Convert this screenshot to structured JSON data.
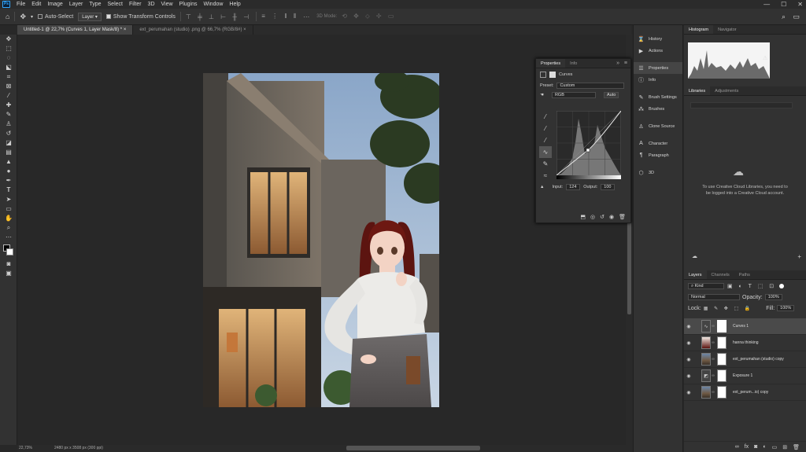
{
  "app": {
    "logo": "Ps"
  },
  "menu": [
    "File",
    "Edit",
    "Image",
    "Layer",
    "Type",
    "Select",
    "Filter",
    "3D",
    "View",
    "Plugins",
    "Window",
    "Help"
  ],
  "window_controls": {
    "minimize": "—",
    "maximize": "☐",
    "close": "✕"
  },
  "options": {
    "auto_select_label": "Auto-Select",
    "auto_select_target": "Layer",
    "transform_controls_label": "Show Transform Controls",
    "mode_3d_label": "3D Mode:"
  },
  "tabs": [
    {
      "label": "Untitled-1 @ 22,7% (Curves 1, Layer Mask/8) *",
      "close": "×"
    },
    {
      "label": "ext_perumahan (studio) .png @ 66,7% (RGB/8#)",
      "close": "×"
    }
  ],
  "status": {
    "zoom": "22,73%",
    "doc_info": "2480 px x 3508 px (300 ppi)"
  },
  "dock": {
    "history": "History",
    "actions": "Actions",
    "properties": "Properties",
    "info": "Info",
    "brush_settings": "Brush Settings",
    "brushes": "Brushes",
    "clone_source": "Clone Source",
    "character": "Character",
    "paragraph": "Paragraph",
    "3d": "3D"
  },
  "properties_panel": {
    "tab_properties": "Properties",
    "tab_info": "Info",
    "adjustment_name": "Curves",
    "preset_label": "Preset:",
    "preset_value": "Custom",
    "channel_value": "RGB",
    "auto_label": "Auto",
    "input_label": "Input:",
    "input_value": "124",
    "output_label": "Output:",
    "output_value": "100"
  },
  "histogram_panel": {
    "tab_histogram": "Histogram",
    "tab_navigator": "Navigator",
    "warning": "⚠"
  },
  "libraries_panel": {
    "tab_libraries": "Libraries",
    "tab_adjustments": "Adjustments",
    "message": "To use Creative Cloud Libraries, you need to be logged into a Creative Cloud account."
  },
  "layers_panel": {
    "tab_layers": "Layers",
    "tab_channels": "Channels",
    "tab_paths": "Paths",
    "filter_kind": "Kind",
    "blend_mode": "Normal",
    "opacity_label": "Opacity:",
    "opacity_value": "100%",
    "lock_label": "Lock:",
    "fill_label": "Fill:",
    "fill_value": "100%",
    "layers": [
      {
        "name": "Curves 1"
      },
      {
        "name": "hanna thinking"
      },
      {
        "name": "ext_perumahan (studio) copy"
      },
      {
        "name": "Exposure 1"
      },
      {
        "name": "ext_perum...io) copy"
      }
    ]
  },
  "colors": {
    "accent": "#31a8ff",
    "ui_bg": "#323232",
    "canvas_bg": "#282828"
  }
}
